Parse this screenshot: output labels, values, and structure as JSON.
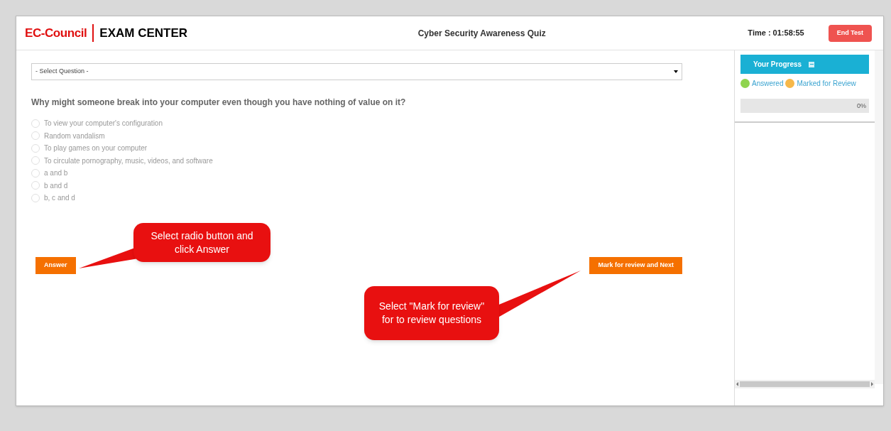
{
  "header": {
    "brand": "EC-Council",
    "product": "EXAM CENTER",
    "title": "Cyber Security Awareness Quiz",
    "timer": "Time : 01:58:55",
    "end_button": "End Test"
  },
  "question_select": {
    "value": "- Select Question -"
  },
  "question": {
    "text": "Why might someone break into your computer even though you have nothing of value on it?",
    "options": [
      {
        "label": "To view your computer's configuration",
        "selected": false
      },
      {
        "label": "Random vandalism",
        "selected": false
      },
      {
        "label": "To play games on your computer",
        "selected": false
      },
      {
        "label": "To circulate pornography, music, videos, and software",
        "selected": false
      },
      {
        "label": "a and b",
        "selected": false
      },
      {
        "label": "b and d",
        "selected": false
      },
      {
        "label": "b, c and d",
        "selected": false
      }
    ]
  },
  "buttons": {
    "answer": "Answer",
    "mark_next": "Mark for review and Next"
  },
  "callouts": [
    {
      "text": "Select radio button and click Answer"
    },
    {
      "text": "Select \"Mark for review\" for to review questions"
    }
  ],
  "progress": {
    "title": "Your Progress",
    "legend": [
      {
        "label": "Answered",
        "color": "#8fd44f"
      },
      {
        "label": "Marked for Review",
        "color": "#f6b84a"
      }
    ],
    "level": 0,
    "reading": "0%"
  }
}
